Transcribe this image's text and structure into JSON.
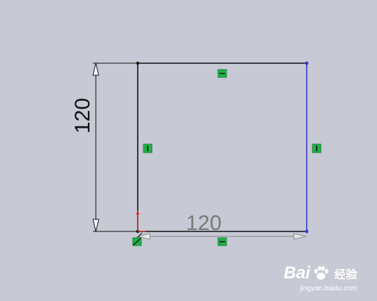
{
  "sketch": {
    "vertical_dimension": "120",
    "horizontal_dimension": "120",
    "colors": {
      "background": "#c7c9d4",
      "line_default": "#111111",
      "line_selected": "#3a3acd",
      "relation_badge": "#21b24a",
      "origin_axis": "#e0282a",
      "dimension_inactive": "#7a7a7a"
    },
    "relation_icons": [
      "horizontal-relation-icon",
      "vertical-relation-icon",
      "coincident-relation-icon"
    ]
  },
  "watermark": {
    "logo_text": "Bai",
    "logo_text_2": "经验",
    "url": "jingyan.baidu.com"
  }
}
